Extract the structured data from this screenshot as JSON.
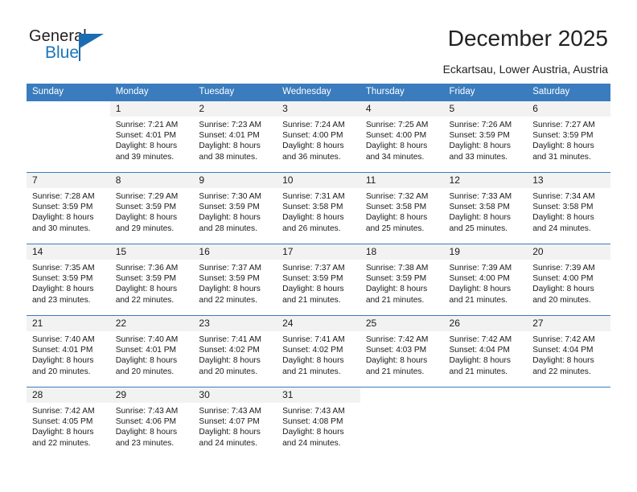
{
  "brand": {
    "name_part1": "General",
    "name_part2": "Blue"
  },
  "header": {
    "title": "December 2025",
    "location": "Eckartsau, Lower Austria, Austria"
  },
  "calendar": {
    "weekday_headers": [
      "Sunday",
      "Monday",
      "Tuesday",
      "Wednesday",
      "Thursday",
      "Friday",
      "Saturday"
    ],
    "accent_color": "#3a7cbe",
    "daynum_band_color": "#f2f2f2",
    "weeks": [
      [
        {
          "day": "",
          "sunrise": "",
          "sunset": "",
          "daylight1": "",
          "daylight2": ""
        },
        {
          "day": "1",
          "sunrise": "Sunrise: 7:21 AM",
          "sunset": "Sunset: 4:01 PM",
          "daylight1": "Daylight: 8 hours",
          "daylight2": "and 39 minutes."
        },
        {
          "day": "2",
          "sunrise": "Sunrise: 7:23 AM",
          "sunset": "Sunset: 4:01 PM",
          "daylight1": "Daylight: 8 hours",
          "daylight2": "and 38 minutes."
        },
        {
          "day": "3",
          "sunrise": "Sunrise: 7:24 AM",
          "sunset": "Sunset: 4:00 PM",
          "daylight1": "Daylight: 8 hours",
          "daylight2": "and 36 minutes."
        },
        {
          "day": "4",
          "sunrise": "Sunrise: 7:25 AM",
          "sunset": "Sunset: 4:00 PM",
          "daylight1": "Daylight: 8 hours",
          "daylight2": "and 34 minutes."
        },
        {
          "day": "5",
          "sunrise": "Sunrise: 7:26 AM",
          "sunset": "Sunset: 3:59 PM",
          "daylight1": "Daylight: 8 hours",
          "daylight2": "and 33 minutes."
        },
        {
          "day": "6",
          "sunrise": "Sunrise: 7:27 AM",
          "sunset": "Sunset: 3:59 PM",
          "daylight1": "Daylight: 8 hours",
          "daylight2": "and 31 minutes."
        }
      ],
      [
        {
          "day": "7",
          "sunrise": "Sunrise: 7:28 AM",
          "sunset": "Sunset: 3:59 PM",
          "daylight1": "Daylight: 8 hours",
          "daylight2": "and 30 minutes."
        },
        {
          "day": "8",
          "sunrise": "Sunrise: 7:29 AM",
          "sunset": "Sunset: 3:59 PM",
          "daylight1": "Daylight: 8 hours",
          "daylight2": "and 29 minutes."
        },
        {
          "day": "9",
          "sunrise": "Sunrise: 7:30 AM",
          "sunset": "Sunset: 3:59 PM",
          "daylight1": "Daylight: 8 hours",
          "daylight2": "and 28 minutes."
        },
        {
          "day": "10",
          "sunrise": "Sunrise: 7:31 AM",
          "sunset": "Sunset: 3:58 PM",
          "daylight1": "Daylight: 8 hours",
          "daylight2": "and 26 minutes."
        },
        {
          "day": "11",
          "sunrise": "Sunrise: 7:32 AM",
          "sunset": "Sunset: 3:58 PM",
          "daylight1": "Daylight: 8 hours",
          "daylight2": "and 25 minutes."
        },
        {
          "day": "12",
          "sunrise": "Sunrise: 7:33 AM",
          "sunset": "Sunset: 3:58 PM",
          "daylight1": "Daylight: 8 hours",
          "daylight2": "and 25 minutes."
        },
        {
          "day": "13",
          "sunrise": "Sunrise: 7:34 AM",
          "sunset": "Sunset: 3:58 PM",
          "daylight1": "Daylight: 8 hours",
          "daylight2": "and 24 minutes."
        }
      ],
      [
        {
          "day": "14",
          "sunrise": "Sunrise: 7:35 AM",
          "sunset": "Sunset: 3:59 PM",
          "daylight1": "Daylight: 8 hours",
          "daylight2": "and 23 minutes."
        },
        {
          "day": "15",
          "sunrise": "Sunrise: 7:36 AM",
          "sunset": "Sunset: 3:59 PM",
          "daylight1": "Daylight: 8 hours",
          "daylight2": "and 22 minutes."
        },
        {
          "day": "16",
          "sunrise": "Sunrise: 7:37 AM",
          "sunset": "Sunset: 3:59 PM",
          "daylight1": "Daylight: 8 hours",
          "daylight2": "and 22 minutes."
        },
        {
          "day": "17",
          "sunrise": "Sunrise: 7:37 AM",
          "sunset": "Sunset: 3:59 PM",
          "daylight1": "Daylight: 8 hours",
          "daylight2": "and 21 minutes."
        },
        {
          "day": "18",
          "sunrise": "Sunrise: 7:38 AM",
          "sunset": "Sunset: 3:59 PM",
          "daylight1": "Daylight: 8 hours",
          "daylight2": "and 21 minutes."
        },
        {
          "day": "19",
          "sunrise": "Sunrise: 7:39 AM",
          "sunset": "Sunset: 4:00 PM",
          "daylight1": "Daylight: 8 hours",
          "daylight2": "and 21 minutes."
        },
        {
          "day": "20",
          "sunrise": "Sunrise: 7:39 AM",
          "sunset": "Sunset: 4:00 PM",
          "daylight1": "Daylight: 8 hours",
          "daylight2": "and 20 minutes."
        }
      ],
      [
        {
          "day": "21",
          "sunrise": "Sunrise: 7:40 AM",
          "sunset": "Sunset: 4:01 PM",
          "daylight1": "Daylight: 8 hours",
          "daylight2": "and 20 minutes."
        },
        {
          "day": "22",
          "sunrise": "Sunrise: 7:40 AM",
          "sunset": "Sunset: 4:01 PM",
          "daylight1": "Daylight: 8 hours",
          "daylight2": "and 20 minutes."
        },
        {
          "day": "23",
          "sunrise": "Sunrise: 7:41 AM",
          "sunset": "Sunset: 4:02 PM",
          "daylight1": "Daylight: 8 hours",
          "daylight2": "and 20 minutes."
        },
        {
          "day": "24",
          "sunrise": "Sunrise: 7:41 AM",
          "sunset": "Sunset: 4:02 PM",
          "daylight1": "Daylight: 8 hours",
          "daylight2": "and 21 minutes."
        },
        {
          "day": "25",
          "sunrise": "Sunrise: 7:42 AM",
          "sunset": "Sunset: 4:03 PM",
          "daylight1": "Daylight: 8 hours",
          "daylight2": "and 21 minutes."
        },
        {
          "day": "26",
          "sunrise": "Sunrise: 7:42 AM",
          "sunset": "Sunset: 4:04 PM",
          "daylight1": "Daylight: 8 hours",
          "daylight2": "and 21 minutes."
        },
        {
          "day": "27",
          "sunrise": "Sunrise: 7:42 AM",
          "sunset": "Sunset: 4:04 PM",
          "daylight1": "Daylight: 8 hours",
          "daylight2": "and 22 minutes."
        }
      ],
      [
        {
          "day": "28",
          "sunrise": "Sunrise: 7:42 AM",
          "sunset": "Sunset: 4:05 PM",
          "daylight1": "Daylight: 8 hours",
          "daylight2": "and 22 minutes."
        },
        {
          "day": "29",
          "sunrise": "Sunrise: 7:43 AM",
          "sunset": "Sunset: 4:06 PM",
          "daylight1": "Daylight: 8 hours",
          "daylight2": "and 23 minutes."
        },
        {
          "day": "30",
          "sunrise": "Sunrise: 7:43 AM",
          "sunset": "Sunset: 4:07 PM",
          "daylight1": "Daylight: 8 hours",
          "daylight2": "and 24 minutes."
        },
        {
          "day": "31",
          "sunrise": "Sunrise: 7:43 AM",
          "sunset": "Sunset: 4:08 PM",
          "daylight1": "Daylight: 8 hours",
          "daylight2": "and 24 minutes."
        },
        {
          "day": "",
          "sunrise": "",
          "sunset": "",
          "daylight1": "",
          "daylight2": ""
        },
        {
          "day": "",
          "sunrise": "",
          "sunset": "",
          "daylight1": "",
          "daylight2": ""
        },
        {
          "day": "",
          "sunrise": "",
          "sunset": "",
          "daylight1": "",
          "daylight2": ""
        }
      ]
    ]
  }
}
